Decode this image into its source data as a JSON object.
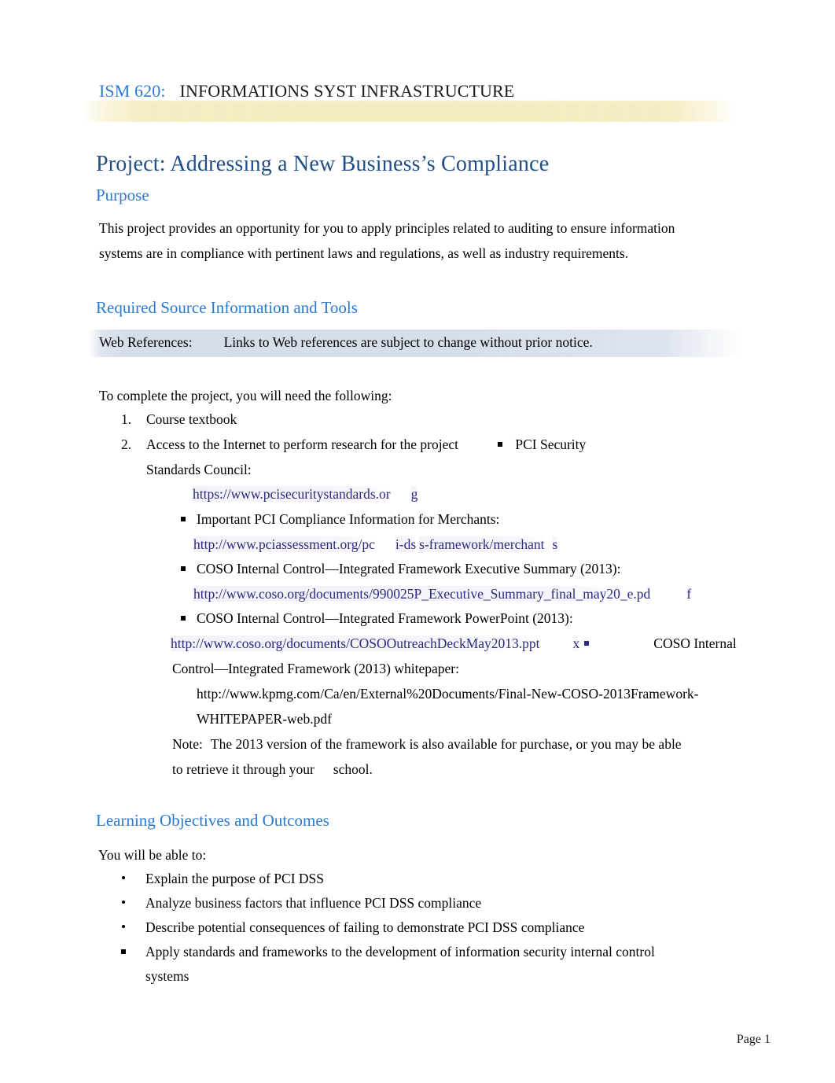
{
  "header": {
    "course_code": "ISM 620:",
    "course_name": "INFORMATIONS SYST INFRASTRUCTURE"
  },
  "title": "Project: Addressing a New Business’s Compliance",
  "sections": {
    "purpose": {
      "heading": "Purpose",
      "body": "This project provides an opportunity for you to apply principles related to auditing to ensure information systems are in compliance with pertinent laws and regulations, as well as industry requirements."
    },
    "required_sources": {
      "heading": "Required Source Information and Tools",
      "web_references_label": "Web References:",
      "web_references_note": "Links to Web references are subject to change without prior notice.",
      "intro": "To complete the project, you will need the following:",
      "items": [
        {
          "number": "1.",
          "text": "Course textbook"
        },
        {
          "number": "2.",
          "text": "Access to the Internet to perform research for the project",
          "trailing_bullet_text": "PCI Security"
        }
      ],
      "continuation": "Standards Council:",
      "links": [
        {
          "url_main": "https://www.pcisecuritystandards.or",
          "url_tail": "g"
        },
        {
          "bullet_label": "Important PCI Compliance Information for Merchants:",
          "url_main": "http://www.pciassessment.org/pc",
          "url_mid": "i-ds",
          "url_mid2": "s-framework/merchant",
          "url_tail": "s"
        },
        {
          "bullet_label": "COSO Internal Control—Integrated Framework Executive Summary (2013):",
          "url_main": "http://www.coso.org/documents/990025P_Executive_Summary_final_may20_e.pd",
          "url_tail": "f"
        },
        {
          "bullet_label": "COSO Internal Control—Integrated Framework PowerPoint (2013):",
          "url_main": "http://www.coso.org/documents/COSOOutreachDeckMay2013.ppt",
          "url_tail": "x",
          "after_bullet_text": "COSO Internal"
        }
      ],
      "whitepaper_line": "Control—Integrated Framework (2013) whitepaper:",
      "whitepaper_url_line1": "http://www.kpmg.com/Ca/en/External%20Documents/Final-New-COSO-2013Framework-",
      "whitepaper_url_line2": "WHITEPAPER-web.pdf",
      "note_label": "Note:",
      "note_line1": "The 2013 version of the framework is also available for purchase, or you may be able",
      "note_line2_a": "to retrieve it through your",
      "note_line2_b": "school."
    },
    "objectives": {
      "heading": "Learning Objectives and Outcomes",
      "intro": "You will be able to:",
      "items": [
        {
          "marker": "dot",
          "text": "Explain the purpose of PCI DSS"
        },
        {
          "marker": "dot",
          "text": "Analyze business factors that influence PCI DSS compliance"
        },
        {
          "marker": "dot",
          "text": "Describe potential consequences of failing to demonstrate PCI DSS compliance"
        },
        {
          "marker": "square",
          "text": "Apply standards and frameworks to the development of information security internal control"
        },
        {
          "marker": "none",
          "text": "systems"
        }
      ]
    }
  },
  "footer": {
    "page_label": "Page 1"
  },
  "colors": {
    "heading_blue": "#2b7ad1",
    "title_blue": "#1f4e86",
    "link_navy": "#2a2a80",
    "header_band": "#f6ecc1",
    "webref_band": "#d5dde9"
  }
}
